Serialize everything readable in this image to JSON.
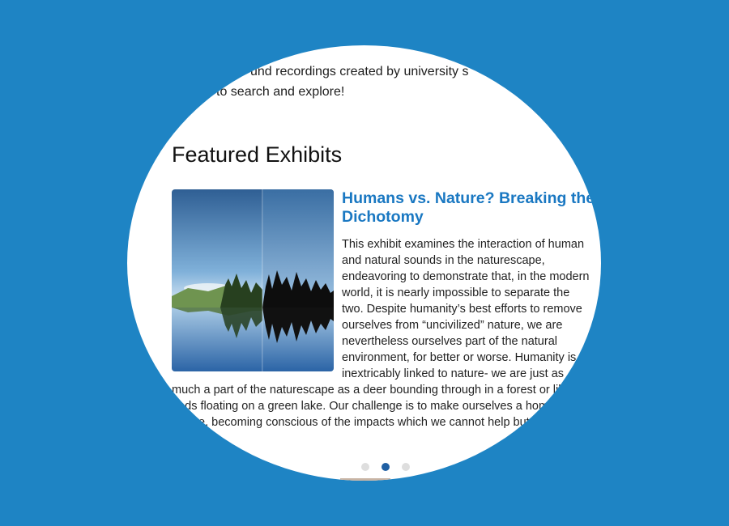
{
  "intro": {
    "line1": "und recordings created by university s",
    "line2": "to search and explore!"
  },
  "featured": {
    "heading": "Featured Exhibits",
    "exhibit": {
      "title": "Humans vs. Nature? Breaking the Dichotomy",
      "body": "This exhibit examines the interaction of human and natural sounds in the naturescape, endeavoring to demonstrate that, in the modern world, it is nearly impossible to separate the two. Despite humanity’s best efforts to remove ourselves from “uncivilized” nature, we are nevertheless ourselves part of the natural environment, for better or worse. Humanity is inextricably linked to nature- we  are just as much a part of the naturescape as a deer bounding through in a forest or lily pads floating on a green lake. Our challenge is to make ourselves a home in nature, becoming conscious of the impacts which we cannot help but leave…",
      "image_icon": "lake-forest-waveform-image"
    }
  },
  "carousel": {
    "dots": 3,
    "active_index": 1
  },
  "colors": {
    "background": "#1e84c4",
    "title_link": "#1a78c2",
    "dot_active": "#1f5fa3",
    "dot_inactive": "#dedede"
  }
}
